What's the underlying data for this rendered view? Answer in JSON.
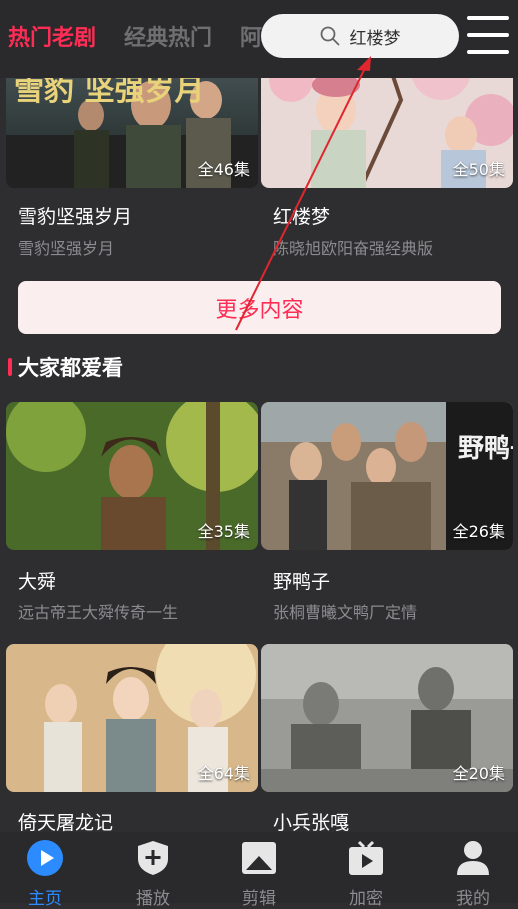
{
  "header": {
    "tabs": [
      "热门老剧",
      "经典热门",
      "阿"
    ],
    "search_text": "红楼梦"
  },
  "top_cards": [
    {
      "title": "雪豹坚强岁月",
      "subtitle": "雪豹坚强岁月",
      "episodes": "全46集",
      "poster_text": "雪豹 坚强岁月"
    },
    {
      "title": "红楼梦",
      "subtitle": "陈晓旭欧阳奋强经典版",
      "episodes": "全50集"
    }
  ],
  "more_button": "更多内容",
  "section_title": "大家都爱看",
  "cards": [
    {
      "title": "大舜",
      "subtitle": "远古帝王大舜传奇一生",
      "episodes": "全35集"
    },
    {
      "title": "野鸭子",
      "subtitle": "张桐曹曦文鸭厂定情",
      "episodes": "全26集",
      "poster_text": "野鸭子"
    },
    {
      "title": "倚天屠龙记",
      "subtitle": "",
      "episodes": "全64集"
    },
    {
      "title": "小兵张嘎",
      "subtitle": "",
      "episodes": "全20集"
    }
  ],
  "bottom_nav": [
    {
      "label": "主页",
      "icon": "play-circle-icon",
      "active": true
    },
    {
      "label": "播放",
      "icon": "shield-plus-icon",
      "active": false
    },
    {
      "label": "剪辑",
      "icon": "image-frame-icon",
      "active": false
    },
    {
      "label": "加密",
      "icon": "tv-play-icon",
      "active": false
    },
    {
      "label": "我的",
      "icon": "user-icon",
      "active": false
    }
  ],
  "colors": {
    "accent": "#ff2d55",
    "nav_active": "#2c8cff",
    "background": "#2e2e30"
  }
}
